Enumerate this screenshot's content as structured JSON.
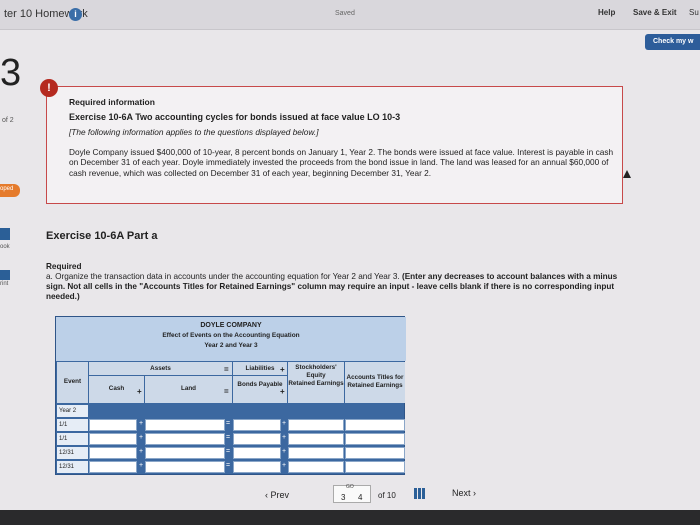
{
  "topbar": {
    "title": "ter 10 Homework",
    "saved": "Saved",
    "help": "Help",
    "save_exit": "Save & Exit",
    "submit": "Su"
  },
  "check_button": "Check my w",
  "question_number": "3",
  "sidebar": {
    "of_label": "of 2",
    "badge": "oped",
    "ebook": "ook",
    "print": "rint"
  },
  "info": {
    "heading": "Required information",
    "exercise": "Exercise 10-6A Two accounting cycles for bonds issued at face value LO 10-3",
    "note": "[The following information applies to the questions displayed below.]",
    "body": "Doyle Company issued $400,000 of 10-year, 8 percent bonds on January 1, Year 2. The bonds were issued at face value. Interest is payable in cash on December 31 of each year. Doyle immediately invested the proceeds from the bond issue in land. The land was leased for an annual $60,000 of cash revenue, which was collected on December 31 of each year, beginning December 31, Year 2."
  },
  "part_title": "Exercise 10-6A Part a",
  "required": {
    "label": "Required",
    "text_normal": "a. Organize the transaction data in accounts under the accounting equation for Year 2 and Year 3. ",
    "text_bold": "(Enter any decreases to account balances with a minus sign. Not all cells in the \"Accounts Titles for Retained Earnings\" column may require an input - leave cells blank if there is no corresponding input needed.)"
  },
  "table": {
    "company": "DOYLE COMPANY",
    "subtitle": "Effect of Events on the Accounting Equation",
    "years": "Year 2 and Year 3",
    "assets": "Assets",
    "liabilities": "Liabilities",
    "equity": "Stockholders' Equity",
    "event": "Event",
    "cash": "Cash",
    "land": "Land",
    "bonds_payable": "Bonds Payable",
    "retained_earnings": "Retained Earnings",
    "acct_titles": "Accounts Titles for Retained Earnings",
    "rows": [
      "Year 2",
      "1/1",
      "1/1",
      "12/31",
      "12/31"
    ]
  },
  "footer": {
    "prev": "Prev",
    "go": "GO",
    "page_current": "3",
    "page_next": "4",
    "of": "of 10",
    "next": "Next"
  }
}
